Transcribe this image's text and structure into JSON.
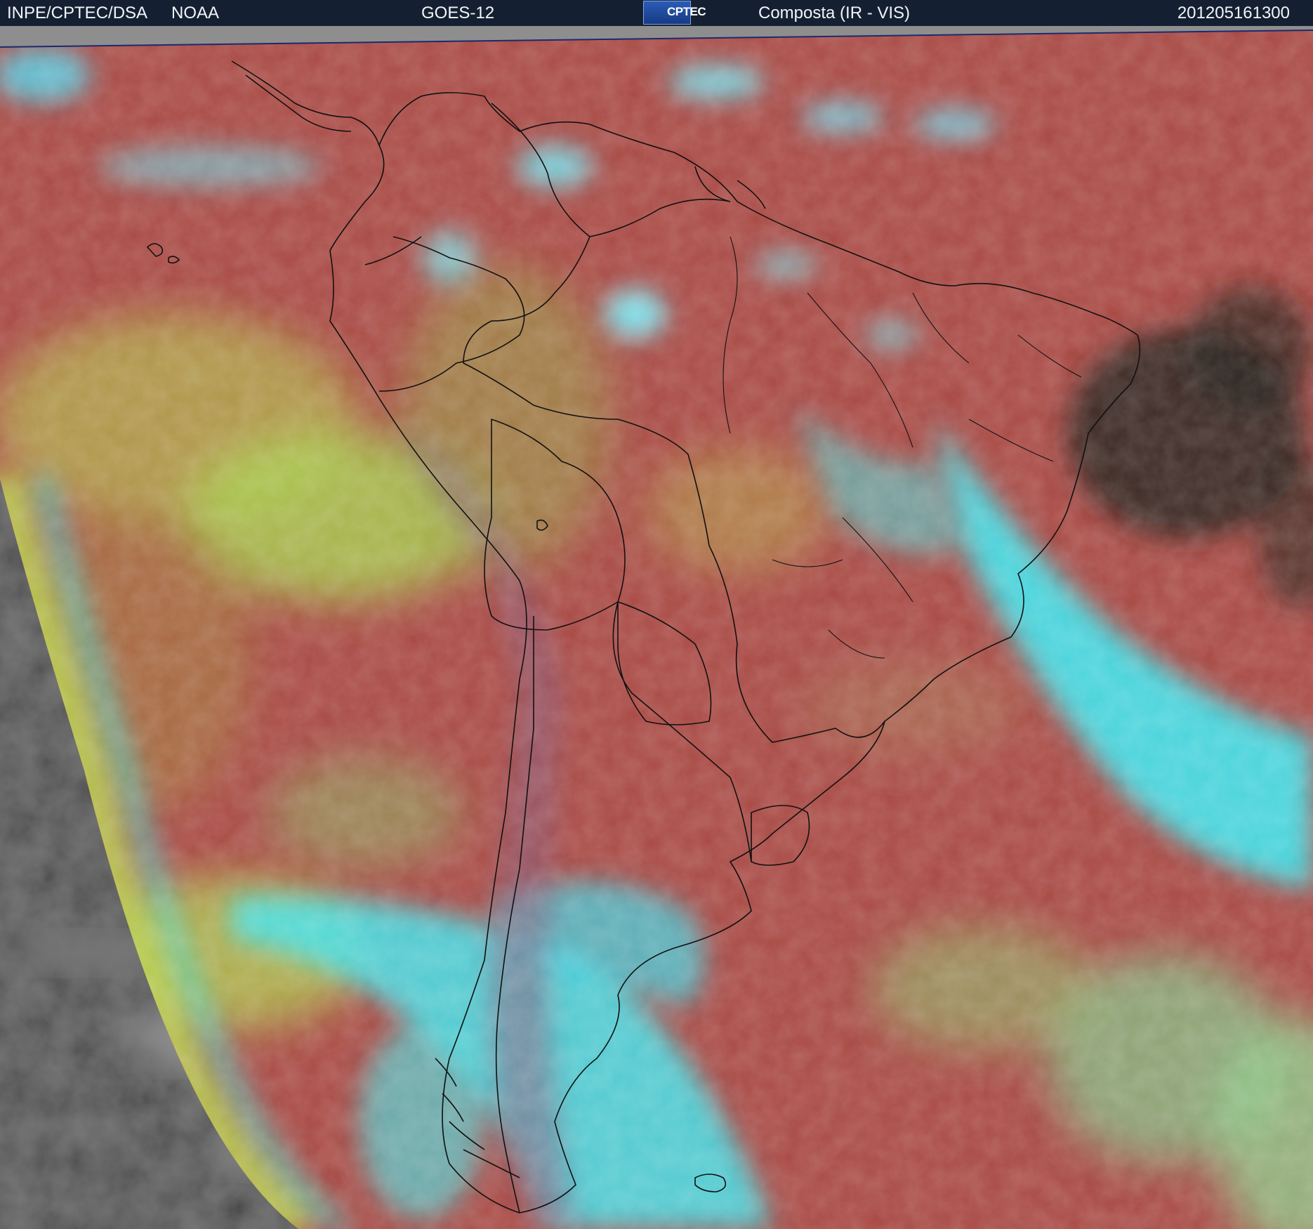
{
  "header": {
    "org": "INPE/CPTEC/DSA",
    "agency": "NOAA",
    "satellite": "GOES-12",
    "logo_text": "CPTEC",
    "product": "Composta (IR - VIS)",
    "timestamp": "201205161300"
  },
  "colors": {
    "header_bg": "#142032",
    "header_text": "#f2f4f8",
    "space_gray": "#8e8e8e",
    "outer_disk_gray": "#4a4a4a",
    "land_warm": "#a94a45",
    "low_cloud": "#a9d64c",
    "high_cloud": "#3fe6e8",
    "border_lines": "#111111"
  }
}
